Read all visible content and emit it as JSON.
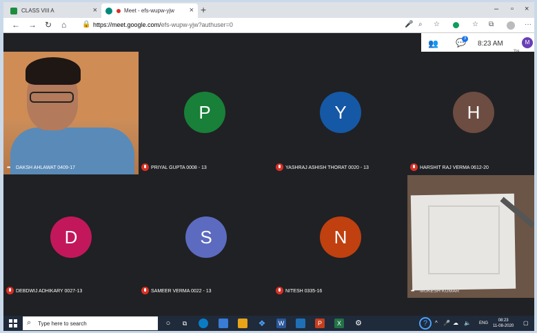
{
  "browser": {
    "tabs": [
      {
        "label": "CLASS VIII A",
        "icon": "classroom-icon",
        "color": "#1e8e3e"
      },
      {
        "label": "Meet - efs-wupw-yjw",
        "icon": "meet-icon",
        "active": true
      }
    ],
    "new_tab": "+",
    "window_controls": {
      "minimize": "–",
      "maximize": "▫",
      "close": "×"
    },
    "url_host": "https://meet.google.com/",
    "url_path": "efs-wupw-yjw?authuser=0"
  },
  "meet": {
    "chat_badge": "3",
    "time": "8:23 AM",
    "self_initial": "M",
    "self_label": "You"
  },
  "participants": [
    {
      "name": "DAKSH AHLAWAT 0409-17",
      "camera": true,
      "muted": false
    },
    {
      "name": "PRIYAL GUPTA 0008 - 13",
      "initial": "P",
      "color": "#188038",
      "muted": true
    },
    {
      "name": "YASHRAJ ASHISH THORAT 0020 - 13",
      "initial": "Y",
      "color": "#1558a6",
      "muted": true
    },
    {
      "name": "HARSHIT RAJ VERMA 0612-20",
      "initial": "H",
      "color": "#6d4c41",
      "muted": true
    },
    {
      "name": "DEBDWIJ ADHIKARY 0027-13",
      "initial": "D",
      "color": "#c2185b",
      "muted": true
    },
    {
      "name": "SAMEER VERMA 0022 - 13",
      "initial": "S",
      "color": "#5c6bc0",
      "muted": true
    },
    {
      "name": "NITESH 0335-16",
      "initial": "N",
      "color": "#c0400f",
      "muted": true
    },
    {
      "name": "MUKESH KUMAR",
      "camera": true,
      "muted": false
    }
  ],
  "taskbar": {
    "search_placeholder": "Type here to search",
    "language": "ENG",
    "clock_time": "08:23",
    "clock_date": "11-08-2020"
  }
}
